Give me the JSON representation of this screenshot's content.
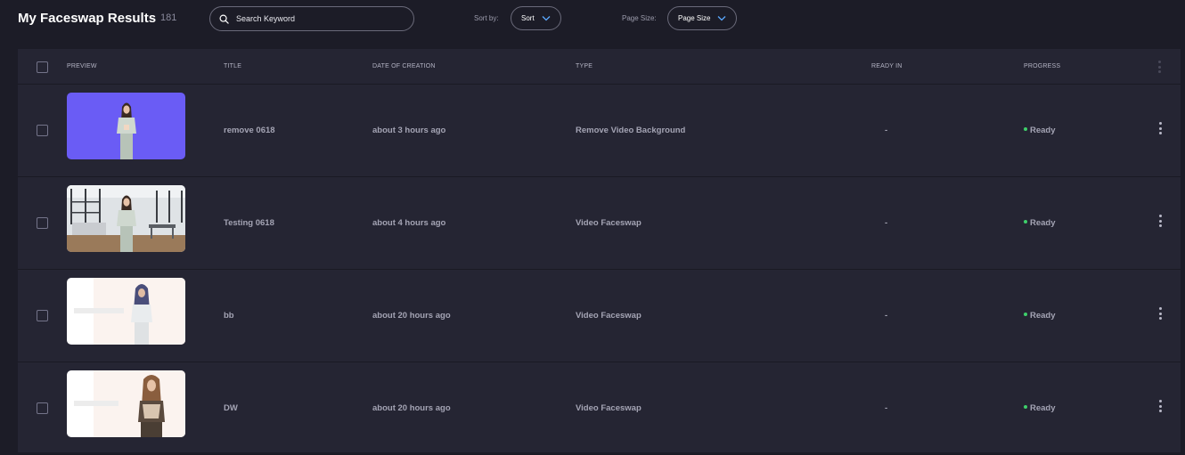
{
  "header": {
    "title": "My Faceswap Results",
    "count": "181",
    "search": {
      "placeholder": "Search Keyword",
      "value": ""
    },
    "sort": {
      "label": "Sort by:",
      "value": "Sort"
    },
    "page_size": {
      "label": "Page Size:",
      "value": "Page Size"
    }
  },
  "table": {
    "columns": [
      "PREVIEW",
      "TITLE",
      "DATE OF CREATION",
      "TYPE",
      "READY IN",
      "PROGRESS"
    ],
    "rows": [
      {
        "title": "remove 0618",
        "date": "about 3 hours ago",
        "type": "Remove Video Background",
        "ready_in": "-",
        "progress": "Ready",
        "preview": "purple-background"
      },
      {
        "title": "Testing 0618",
        "date": "about 4 hours ago",
        "type": "Video Faceswap",
        "ready_in": "-",
        "progress": "Ready",
        "preview": "office-background"
      },
      {
        "title": "bb",
        "date": "about 20 hours ago",
        "type": "Video Faceswap",
        "ready_in": "-",
        "progress": "Ready",
        "preview": "white-background"
      },
      {
        "title": "DW",
        "date": "about 20 hours ago",
        "type": "Video Faceswap",
        "ready_in": "-",
        "progress": "Ready",
        "preview": "white-background"
      }
    ]
  },
  "colors": {
    "background": "#1c1c27",
    "panel": "#252533",
    "ready_dot": "#3ecf6a",
    "thumb_purple": "#6a5cf5"
  }
}
